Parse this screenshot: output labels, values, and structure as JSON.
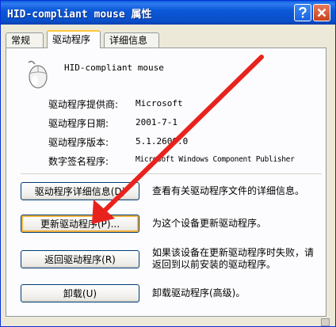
{
  "window": {
    "title": "HID-compliant mouse 属性",
    "help_icon": "help-icon",
    "close_icon": "close-icon"
  },
  "tabs": [
    {
      "label": "常规"
    },
    {
      "label": "驱动程序",
      "selected": true
    },
    {
      "label": "详细信息"
    }
  ],
  "device": {
    "icon": "mouse-icon",
    "name": "HID-compliant mouse"
  },
  "driver_info": [
    {
      "label": "驱动程序提供商:",
      "value": "Microsoft"
    },
    {
      "label": "驱动程序日期:",
      "value": "2001-7-1"
    },
    {
      "label": "驱动程序版本:",
      "value": "5.1.2600.0"
    },
    {
      "label": "数字签名程序:",
      "value": "Microsoft Windows Component Publisher"
    }
  ],
  "actions": [
    {
      "button": "驱动程序详细信息(D)",
      "description": "查看有关驱动程序文件的详细信息。"
    },
    {
      "button": "更新驱动程序(P)...",
      "description": "为这个设备更新驱动程序。"
    },
    {
      "button": "返回驱动程序(R)",
      "description_line1": "如果该设备在更新驱动程序时失败，请",
      "description_line2": "返回到以前安装的驱动程序。"
    },
    {
      "button": "卸载(U)",
      "description": "卸载驱动程序(高级)。"
    }
  ],
  "annotation": {
    "type": "red-arrow",
    "color": "#e8231e"
  }
}
